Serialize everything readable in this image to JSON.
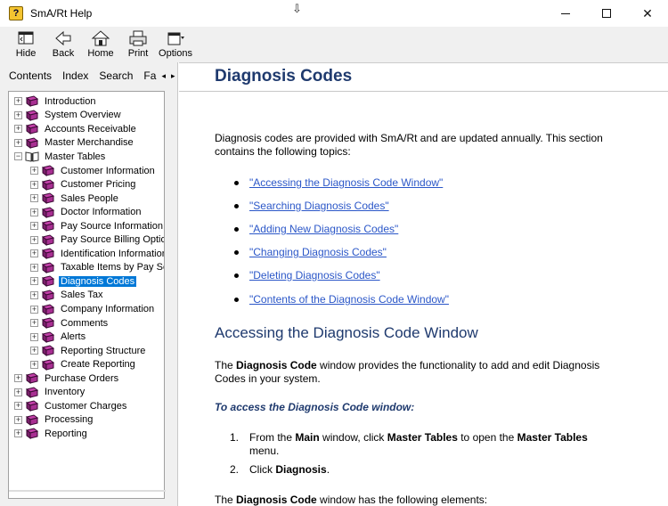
{
  "window": {
    "title": "SmA/Rt Help",
    "app_icon": "help-book-icon"
  },
  "toolbar": {
    "buttons": [
      {
        "label": "Hide",
        "icon": "hide-icon"
      },
      {
        "label": "Back",
        "icon": "back-arrow-icon"
      },
      {
        "label": "Home",
        "icon": "home-icon"
      },
      {
        "label": "Print",
        "icon": "printer-icon"
      },
      {
        "label": "Options",
        "icon": "options-icon"
      }
    ]
  },
  "nav_tabs": [
    "Contents",
    "Index",
    "Search",
    "Fa"
  ],
  "tree": {
    "items": [
      {
        "label": "Introduction",
        "level": 0,
        "expanded": false,
        "selected": false
      },
      {
        "label": "System Overview",
        "level": 0,
        "expanded": false,
        "selected": false
      },
      {
        "label": "Accounts Receivable",
        "level": 0,
        "expanded": false,
        "selected": false
      },
      {
        "label": "Master Merchandise",
        "level": 0,
        "expanded": false,
        "selected": false
      },
      {
        "label": "Master Tables",
        "level": 0,
        "expanded": true,
        "selected": false
      },
      {
        "label": "Customer Information",
        "level": 1,
        "expanded": false,
        "selected": false
      },
      {
        "label": "Customer Pricing",
        "level": 1,
        "expanded": false,
        "selected": false
      },
      {
        "label": "Sales People",
        "level": 1,
        "expanded": false,
        "selected": false
      },
      {
        "label": "Doctor Information",
        "level": 1,
        "expanded": false,
        "selected": false
      },
      {
        "label": "Pay Source Information",
        "level": 1,
        "expanded": false,
        "selected": false
      },
      {
        "label": "Pay Source Billing Optio",
        "level": 1,
        "expanded": false,
        "selected": false
      },
      {
        "label": "Identification Information",
        "level": 1,
        "expanded": false,
        "selected": false
      },
      {
        "label": "Taxable Items by Pay Sc",
        "level": 1,
        "expanded": false,
        "selected": false
      },
      {
        "label": "Diagnosis Codes",
        "level": 1,
        "expanded": false,
        "selected": true
      },
      {
        "label": "Sales Tax",
        "level": 1,
        "expanded": false,
        "selected": false
      },
      {
        "label": "Company Information",
        "level": 1,
        "expanded": false,
        "selected": false
      },
      {
        "label": "Comments",
        "level": 1,
        "expanded": false,
        "selected": false
      },
      {
        "label": "Alerts",
        "level": 1,
        "expanded": false,
        "selected": false
      },
      {
        "label": "Reporting Structure",
        "level": 1,
        "expanded": false,
        "selected": false
      },
      {
        "label": "Create Reporting",
        "level": 1,
        "expanded": false,
        "selected": false
      },
      {
        "label": "Purchase Orders",
        "level": 0,
        "expanded": false,
        "selected": false
      },
      {
        "label": "Inventory",
        "level": 0,
        "expanded": false,
        "selected": false
      },
      {
        "label": "Customer Charges",
        "level": 0,
        "expanded": false,
        "selected": false
      },
      {
        "label": "Processing",
        "level": 0,
        "expanded": false,
        "selected": false
      },
      {
        "label": "Reporting",
        "level": 0,
        "expanded": false,
        "selected": false
      }
    ]
  },
  "content": {
    "title": "Diagnosis Codes",
    "intro": "Diagnosis codes are provided with SmA/Rt and are updated annually. This section contains the following topics:",
    "links": [
      "\"Accessing the Diagnosis Code Window\"",
      "\"Searching Diagnosis Codes\"",
      "\"Adding New Diagnosis Codes\"",
      "\"Changing Diagnosis Codes\"",
      "\"Deleting Diagnosis Codes\"",
      "\"Contents of the Diagnosis Code Window\""
    ],
    "section_heading": "Accessing the Diagnosis Code Window",
    "section_para": {
      "pre": "The ",
      "bold": "Diagnosis Code",
      "post": " window provides the functionality to add and edit Diagnosis Codes in your system."
    },
    "procedure_heading": "To access the Diagnosis Code window:",
    "steps": [
      {
        "num": "1.",
        "parts": [
          "From the ",
          "Main",
          " window, click ",
          "Master Tables",
          " to open the ",
          "Master Tables",
          " menu."
        ]
      },
      {
        "num": "2.",
        "parts": [
          "Click ",
          "Diagnosis",
          "."
        ]
      }
    ],
    "elements_para": {
      "pre": "The ",
      "bold": "Diagnosis Code",
      "post": " window has the following elements:"
    }
  }
}
